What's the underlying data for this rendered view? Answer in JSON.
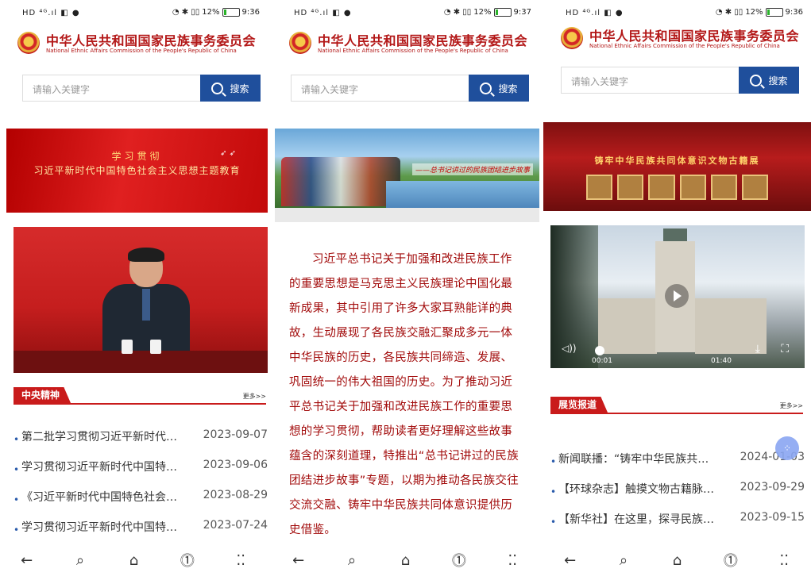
{
  "screens": [
    {
      "status": {
        "left": "HD ⁴ᴳ.ıl ◧ ●",
        "battery_pct": "12%",
        "icons": "◔ ✱ ▯▯",
        "time": "9:36"
      },
      "header": {
        "title_cn": "中华人民共和国国家民族事务委员会",
        "title_en": "National Ethnic Affairs Commission of the People's Republic of China"
      },
      "search": {
        "placeholder": "请输入关键字",
        "button": "搜索"
      },
      "banner": {
        "line1": "学习贯彻",
        "line2": "习近平新时代中国特色社会主义思想主题教育"
      },
      "section": {
        "tag": "中央精神",
        "more": "更多>>"
      },
      "news": [
        {
          "title": "第二批学习贯彻习近平新时代…",
          "date": "2023-09-07"
        },
        {
          "title": "学习贯彻习近平新时代中国特…",
          "date": "2023-09-06"
        },
        {
          "title": "《习近平新时代中国特色社会…",
          "date": "2023-08-29"
        },
        {
          "title": "学习贯彻习近平新时代中国特…",
          "date": "2023-07-24"
        }
      ]
    },
    {
      "status": {
        "left": "HD ⁴ᴳ.ıl ◧ ●",
        "battery_pct": "12%",
        "icons": "◔ ✱ ▯▯",
        "time": "9:37"
      },
      "header": {
        "title_cn": "中华人民共和国国家民族事务委员会",
        "title_en": "National Ethnic Affairs Commission of the People's Republic of China"
      },
      "search": {
        "placeholder": "请输入关键字",
        "button": "搜索"
      },
      "banner": {
        "caption": "——总书记讲过的民族团结进步故事"
      },
      "article": "习近平总书记关于加强和改进民族工作的重要思想是马克思主义民族理论中国化最新成果，其中引用了许多大家耳熟能详的典故，生动展现了各民族交融汇聚成多元一体中华民族的历史，各民族共同缔造、发展、巩固统一的伟大祖国的历史。为了推动习近平总书记关于加强和改进民族工作的重要思想的学习贯彻，帮助读者更好理解这些故事蕴含的深刻道理，特推出“总书记讲过的民族团结进步故事”专题，以期为推动各民族交往交流交融、铸牢中华民族共同体意识提供历史借鉴。"
    },
    {
      "status": {
        "left": "HD ⁴ᴳ.ıl ◧ ●",
        "battery_pct": "12%",
        "icons": "◔ ✱ ▯▯",
        "time": "9:36"
      },
      "header": {
        "title_cn": "中华人民共和国国家民族事务委员会",
        "title_en": "National Ethnic Affairs Commission of the People's Republic of China"
      },
      "search": {
        "placeholder": "请输入关键字",
        "button": "搜索"
      },
      "banner": {
        "title": "铸牢中华民族共同体意识文物古籍展"
      },
      "video": {
        "current": "00:01",
        "duration": "01:40",
        "progress": 0.01
      },
      "section": {
        "tag": "展览报道",
        "more": "更多>>"
      },
      "news": [
        {
          "title": "新闻联播：“铸牢中华民族共…",
          "date": "2024-01-03"
        },
        {
          "title": "【环球杂志】触摸文物古籍脉…",
          "date": "2023-09-29"
        },
        {
          "title": "【新华社】在这里，探寻民族…",
          "date": "2023-09-15"
        }
      ]
    }
  ],
  "nav": [
    "←",
    "⌕",
    "⌂",
    "⓵",
    "⁚⁚"
  ],
  "colors": {
    "brand_red": "#c91b1b",
    "search_blue": "#1f4f9c",
    "article_red": "#a20b0b"
  }
}
